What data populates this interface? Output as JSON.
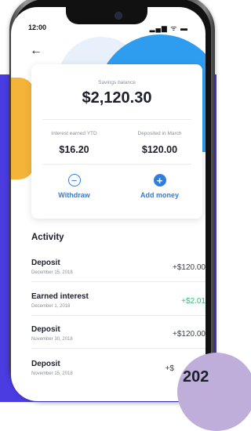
{
  "status_bar": {
    "time": "12:00",
    "icons": "▂▄▆ ᯤ ▬"
  },
  "nav": {
    "back_icon": "←"
  },
  "savings": {
    "label": "Savings balance",
    "balance": "$2,120.30",
    "interest_label": "Interest earned YTD",
    "interest_value": "$16.20",
    "deposited_label": "Deposited in March",
    "deposited_value": "$120.00"
  },
  "actions": {
    "withdraw_icon": "−",
    "withdraw_label": "Withdraw",
    "add_icon": "+",
    "add_label": "Add money"
  },
  "activity": {
    "title": "Activity",
    "items": [
      {
        "title": "Deposit",
        "date": "December 15, 2018",
        "amount": "+$120.00"
      },
      {
        "title": "Earned interest",
        "date": "December 1, 2018",
        "amount": "+$2.01"
      },
      {
        "title": "Deposit",
        "date": "November 30, 2018",
        "amount": "+$120.00"
      },
      {
        "title": "Deposit",
        "date": "November 15, 2018",
        "amount": "+$"
      }
    ]
  },
  "badge": {
    "year": "202"
  },
  "colors": {
    "brand_purple": "#4a3ce0",
    "accent_blue": "#2e7de0",
    "positive_green": "#2ec27e",
    "accent_yellow": "#f4b43a"
  }
}
